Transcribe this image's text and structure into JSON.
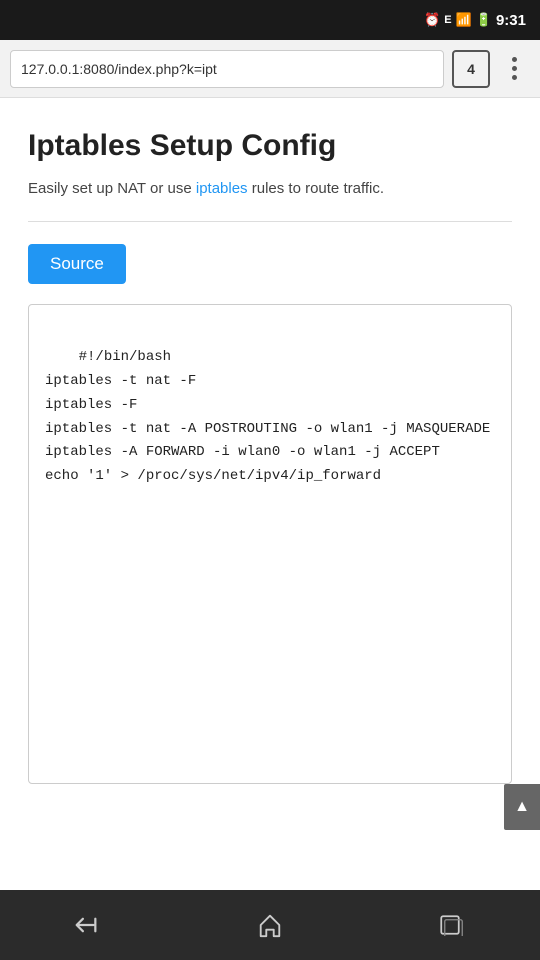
{
  "statusBar": {
    "time": "9:31",
    "icons": [
      "alarm",
      "signal-e",
      "signal-bars",
      "battery"
    ]
  },
  "browserToolbar": {
    "url": "127.0.0.1:8080/index.php?k=ipt",
    "tabCount": "4",
    "tabLabel": "4"
  },
  "page": {
    "title": "Iptables Setup Config",
    "subtitle_pre": "Easily set up NAT or use ",
    "subtitle_link": "iptables",
    "subtitle_post": " rules to route traffic.",
    "source_button": "Source",
    "code": "#!/bin/bash\niptables -t nat -F\niptables -F\niptables -t nat -A POSTROUTING -o wlan1 -j MASQUERADE\niptables -A FORWARD -i wlan0 -o wlan1 -j ACCEPT\necho '1' > /proc/sys/net/ipv4/ip_forward"
  },
  "bottomNav": {
    "back_label": "back",
    "home_label": "home",
    "recents_label": "recents"
  }
}
